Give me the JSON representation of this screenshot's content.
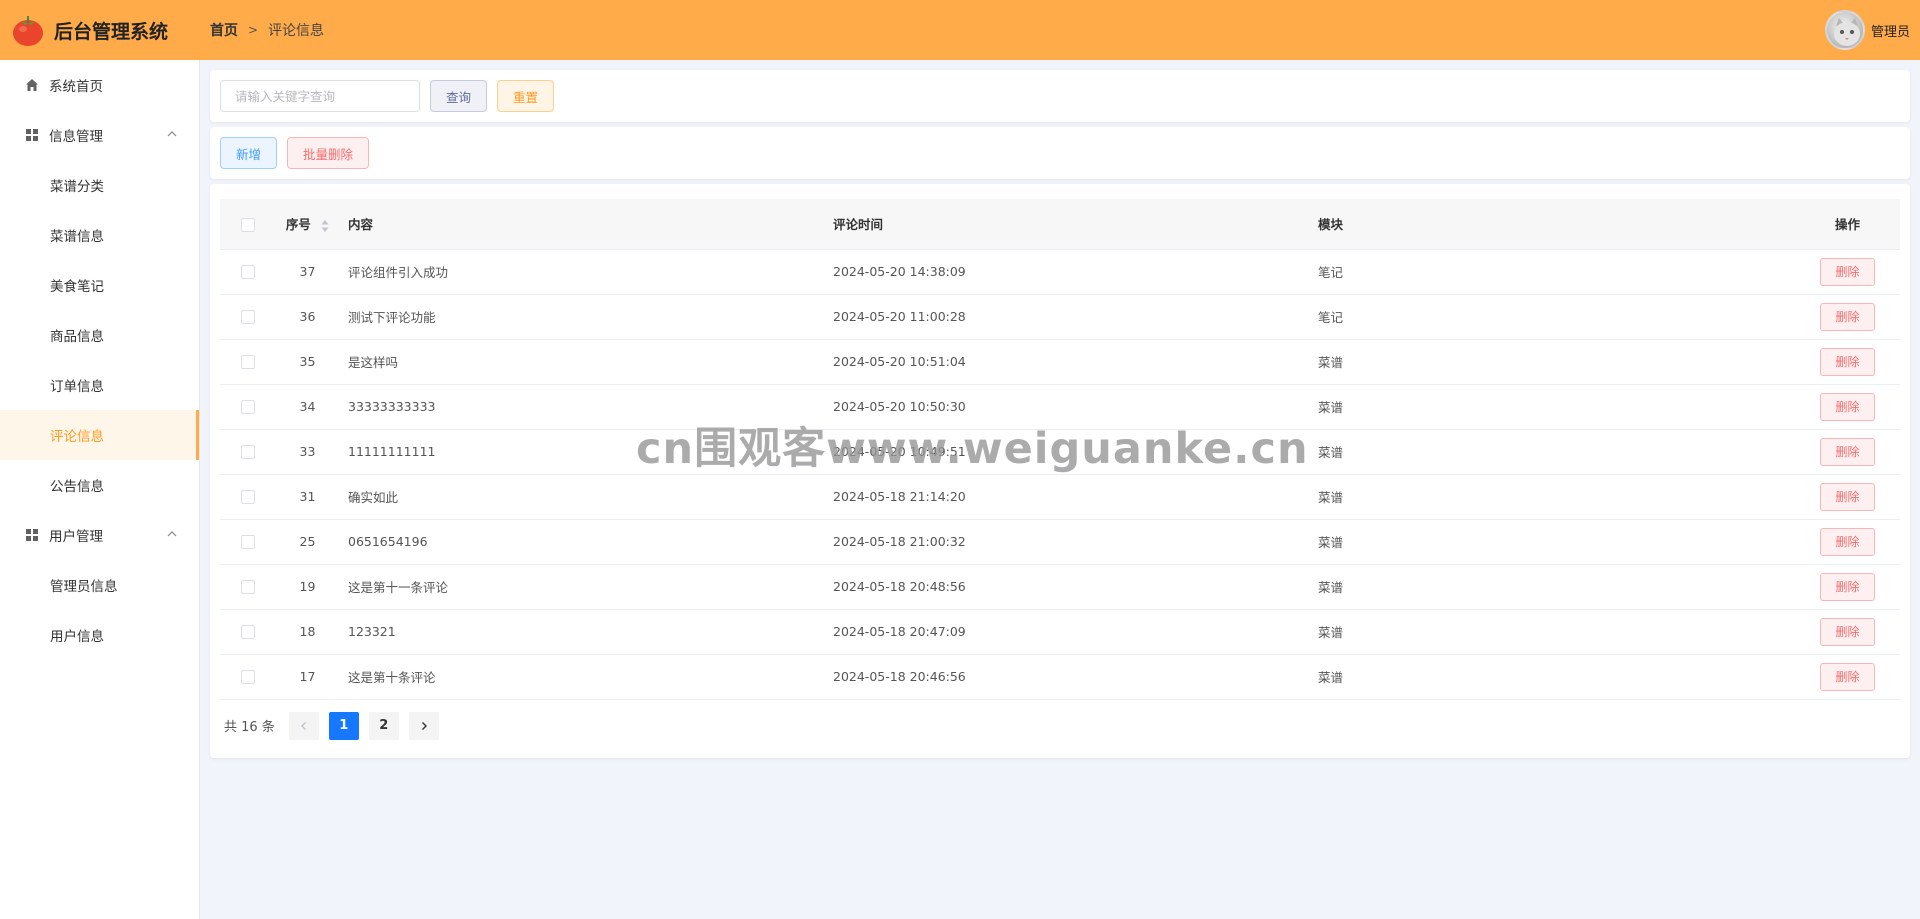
{
  "header": {
    "app_title": "后台管理系统",
    "breadcrumb_home": "首页",
    "breadcrumb_current": "评论信息",
    "user_name": "管理员"
  },
  "sidebar": {
    "items": [
      {
        "label": "系统首页",
        "icon": "home-icon"
      },
      {
        "label": "信息管理",
        "icon": "grid-icon",
        "group": true,
        "expanded": true
      },
      {
        "label": "菜谱分类"
      },
      {
        "label": "菜谱信息"
      },
      {
        "label": "美食笔记"
      },
      {
        "label": "商品信息"
      },
      {
        "label": "订单信息"
      },
      {
        "label": "评论信息",
        "active": true
      },
      {
        "label": "公告信息"
      },
      {
        "label": "用户管理",
        "icon": "grid-icon",
        "group": true,
        "expanded": true
      },
      {
        "label": "管理员信息"
      },
      {
        "label": "用户信息"
      }
    ]
  },
  "search": {
    "placeholder": "请输入关键字查询",
    "value": "",
    "search_label": "查询",
    "reset_label": "重置"
  },
  "toolbar": {
    "add_label": "新增",
    "batch_delete_label": "批量删除"
  },
  "table": {
    "headers": {
      "id": "序号",
      "content": "内容",
      "time": "评论时间",
      "module": "模块",
      "op": "操作"
    },
    "delete_label": "删除",
    "rows": [
      {
        "id": "37",
        "content": "评论组件引入成功",
        "time": "2024-05-20 14:38:09",
        "module": "笔记"
      },
      {
        "id": "36",
        "content": "测试下评论功能",
        "time": "2024-05-20 11:00:28",
        "module": "笔记"
      },
      {
        "id": "35",
        "content": "是这样吗",
        "time": "2024-05-20 10:51:04",
        "module": "菜谱"
      },
      {
        "id": "34",
        "content": "33333333333",
        "time": "2024-05-20 10:50:30",
        "module": "菜谱"
      },
      {
        "id": "33",
        "content": "11111111111",
        "time": "2024-05-20 10:49:51",
        "module": "菜谱"
      },
      {
        "id": "31",
        "content": "确实如此",
        "time": "2024-05-18 21:14:20",
        "module": "菜谱"
      },
      {
        "id": "25",
        "content": "0651654196",
        "time": "2024-05-18 21:00:32",
        "module": "菜谱"
      },
      {
        "id": "19",
        "content": "这是第十一条评论",
        "time": "2024-05-18 20:48:56",
        "module": "菜谱"
      },
      {
        "id": "18",
        "content": "123321",
        "time": "2024-05-18 20:47:09",
        "module": "菜谱"
      },
      {
        "id": "17",
        "content": "这是第十条评论",
        "time": "2024-05-18 20:46:56",
        "module": "菜谱"
      }
    ]
  },
  "pagination": {
    "total_text": "共 16 条",
    "pages": [
      "1",
      "2"
    ],
    "current": "1"
  },
  "watermark": "cn围观客www.weiguanke.cn",
  "colors": {
    "header": "#ffab4a",
    "accent": "#ff9a1f",
    "primary": "#1677ff",
    "danger": "#f56c6c"
  }
}
